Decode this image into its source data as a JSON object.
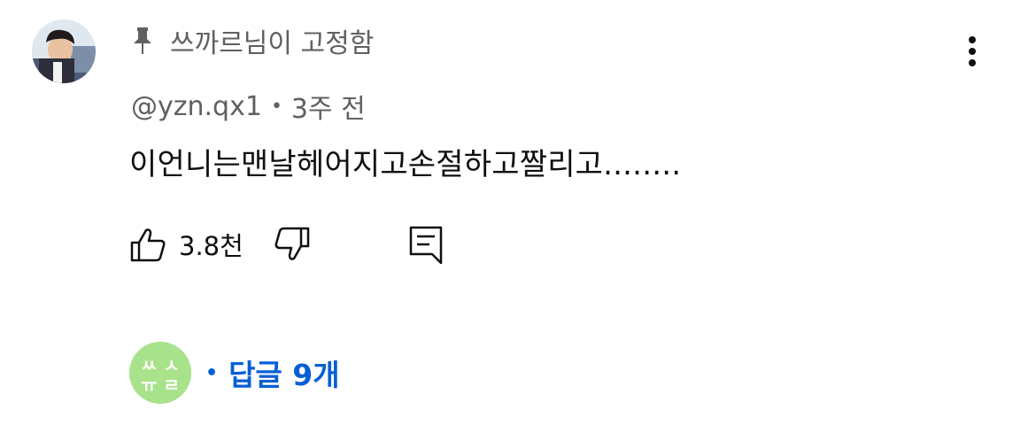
{
  "pinned": {
    "text": "쓰까르님이 고정함"
  },
  "comment": {
    "author": "@yzn.qx1",
    "separator": "•",
    "time": "3주 전",
    "text": "이언니는맨날헤어지고손절하고짤리고........",
    "likes": "3.8천"
  },
  "replies": {
    "separator": "•",
    "label": "답글 9개",
    "avatar_text": "쓰까르"
  },
  "icons": {
    "pin": "pin-icon",
    "more": "more-vert-icon",
    "like": "thumb-up-icon",
    "dislike": "thumb-down-icon",
    "reply": "reply-icon"
  },
  "colors": {
    "link": "#065fd4",
    "secondary_text": "#606060",
    "reply_avatar_bg": "#a8e28a"
  }
}
